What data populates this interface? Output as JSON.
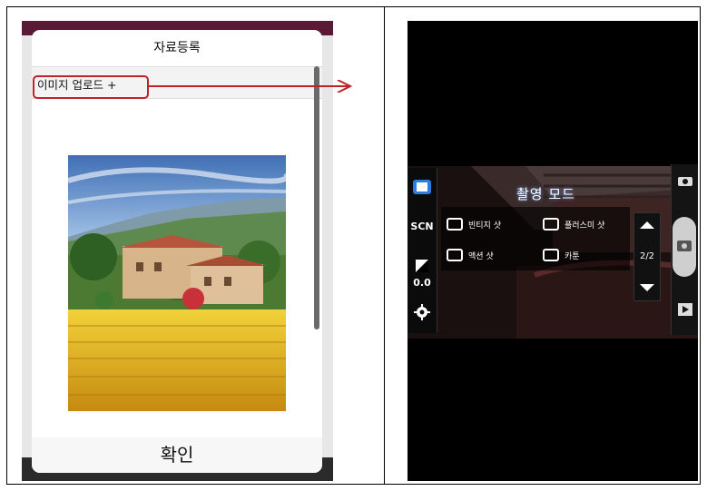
{
  "left_screen": {
    "dialog_title": "자료등록",
    "upload_label": "이미지 업로드 +",
    "confirm_button": "확인",
    "icons": {
      "arrow": "arrow-right-icon"
    }
  },
  "right_screen": {
    "mode_title": "촬영 모드",
    "left_panel": {
      "scn_label": "SCN",
      "exposure_value": "0.0",
      "icons": [
        "screen-mode-icon",
        "exposure-icon",
        "settings-gear-icon"
      ]
    },
    "mode_items": [
      "빈티지 샷",
      "플러스미 샷",
      "액션 샷",
      "카툰"
    ],
    "page_indicator": "2/2",
    "right_panel_icons": [
      "camera-icon",
      "shutter-icon",
      "play-icon"
    ]
  },
  "colors": {
    "highlight_red": "#c0222b",
    "phone_header": "#4e1931"
  }
}
